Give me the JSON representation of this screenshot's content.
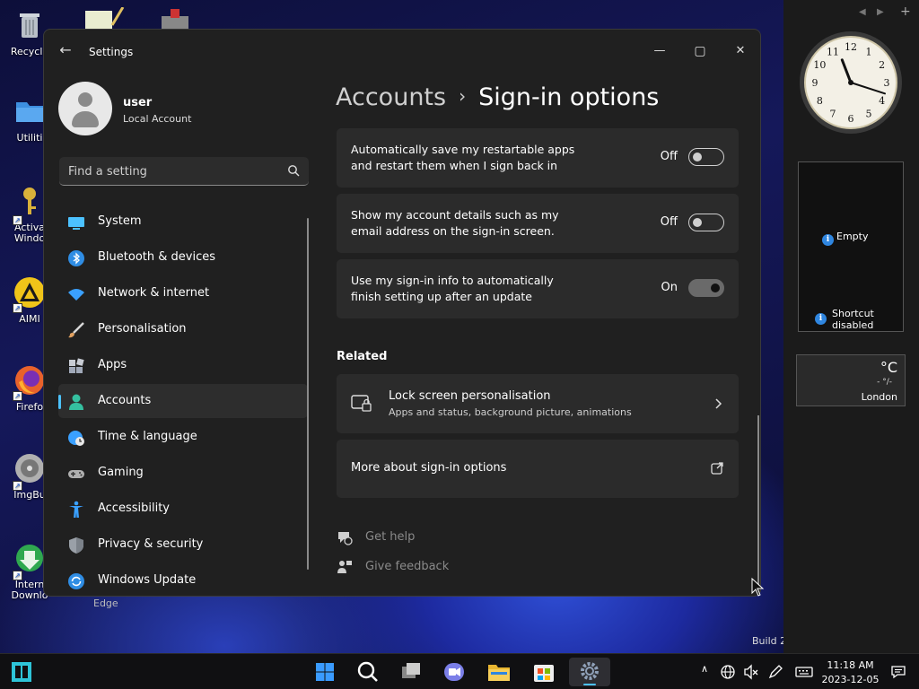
{
  "desktop": {
    "icons": [
      {
        "label": "Recycle",
        "color": "#9aa3ad"
      },
      {
        "label": "Utiliti",
        "color": "#3d8fe0"
      },
      {
        "label": "Activa Windo",
        "color": "#d9b13a"
      },
      {
        "label": "AIMI",
        "color": "#f0c419"
      },
      {
        "label": "Firefo",
        "color": "#e8622c"
      },
      {
        "label": "ImgBu",
        "color": "#b0b0b0"
      },
      {
        "label": "Intern Downlo",
        "color": "#2fa84f"
      }
    ],
    "edge_label": "Edge",
    "build_text": "Build 2"
  },
  "window": {
    "title": "Settings",
    "minimize_glyph": "—",
    "maximize_glyph": "▢",
    "close_glyph": "✕",
    "back_glyph": "←"
  },
  "profile": {
    "name": "user",
    "type": "Local Account"
  },
  "search": {
    "placeholder": "Find a setting"
  },
  "nav": {
    "items": [
      {
        "label": "System",
        "icon": "system-icon",
        "color": "#4cc2ff"
      },
      {
        "label": "Bluetooth & devices",
        "icon": "bluetooth-icon",
        "color": "#2f8de4"
      },
      {
        "label": "Network & internet",
        "icon": "wifi-icon",
        "color": "#3aa0ff"
      },
      {
        "label": "Personalisation",
        "icon": "brush-icon",
        "color": "#e0a060"
      },
      {
        "label": "Apps",
        "icon": "apps-icon",
        "color": "#a0a8b8"
      },
      {
        "label": "Accounts",
        "icon": "accounts-icon",
        "color": "#35c0a0"
      },
      {
        "label": "Time & language",
        "icon": "globe-clock-icon",
        "color": "#3aa0ff"
      },
      {
        "label": "Gaming",
        "icon": "gamepad-icon",
        "color": "#b0b0b0"
      },
      {
        "label": "Accessibility",
        "icon": "accessibility-icon",
        "color": "#3aa0ff"
      },
      {
        "label": "Privacy & security",
        "icon": "shield-icon",
        "color": "#9aa0a8"
      },
      {
        "label": "Windows Update",
        "icon": "update-icon",
        "color": "#2f8de4"
      }
    ],
    "active_index": 5
  },
  "breadcrumb": {
    "parent": "Accounts",
    "separator": "›",
    "current": "Sign-in options"
  },
  "settings": [
    {
      "line1": "Automatically save my restartable apps",
      "line2": "and restart them when I sign back in",
      "state": "Off"
    },
    {
      "line1": "Show my account details such as my",
      "line2": "email address on the sign-in screen.",
      "state": "Off"
    },
    {
      "line1": "Use my sign-in info to automatically",
      "line2": "finish setting up after an update",
      "state": "On"
    }
  ],
  "related": {
    "heading": "Related",
    "lock_title": "Lock screen personalisation",
    "lock_sub": "Apps and status, background picture, animations",
    "more_label": "More about sign-in options"
  },
  "help": {
    "get_help": "Get help",
    "give_feedback": "Give feedback"
  },
  "gadgets": {
    "clock_numbers": [
      "12",
      "1",
      "2",
      "3",
      "4",
      "5",
      "6",
      "7",
      "8",
      "9",
      "10",
      "11"
    ],
    "clock_time": {
      "hour": 11,
      "minute": 18
    },
    "slideshow_empty": "Empty",
    "shortcut_line1": "Shortcut",
    "shortcut_line2": "disabled",
    "weather_unit": "°C",
    "weather_dash": "- °/-",
    "weather_city": "London",
    "nav_prev": "◀",
    "nav_next": "▶",
    "nav_add": "+"
  },
  "taskbar": {
    "time": "11:18 AM",
    "date": "2023-12-05",
    "chevron": "∧"
  }
}
